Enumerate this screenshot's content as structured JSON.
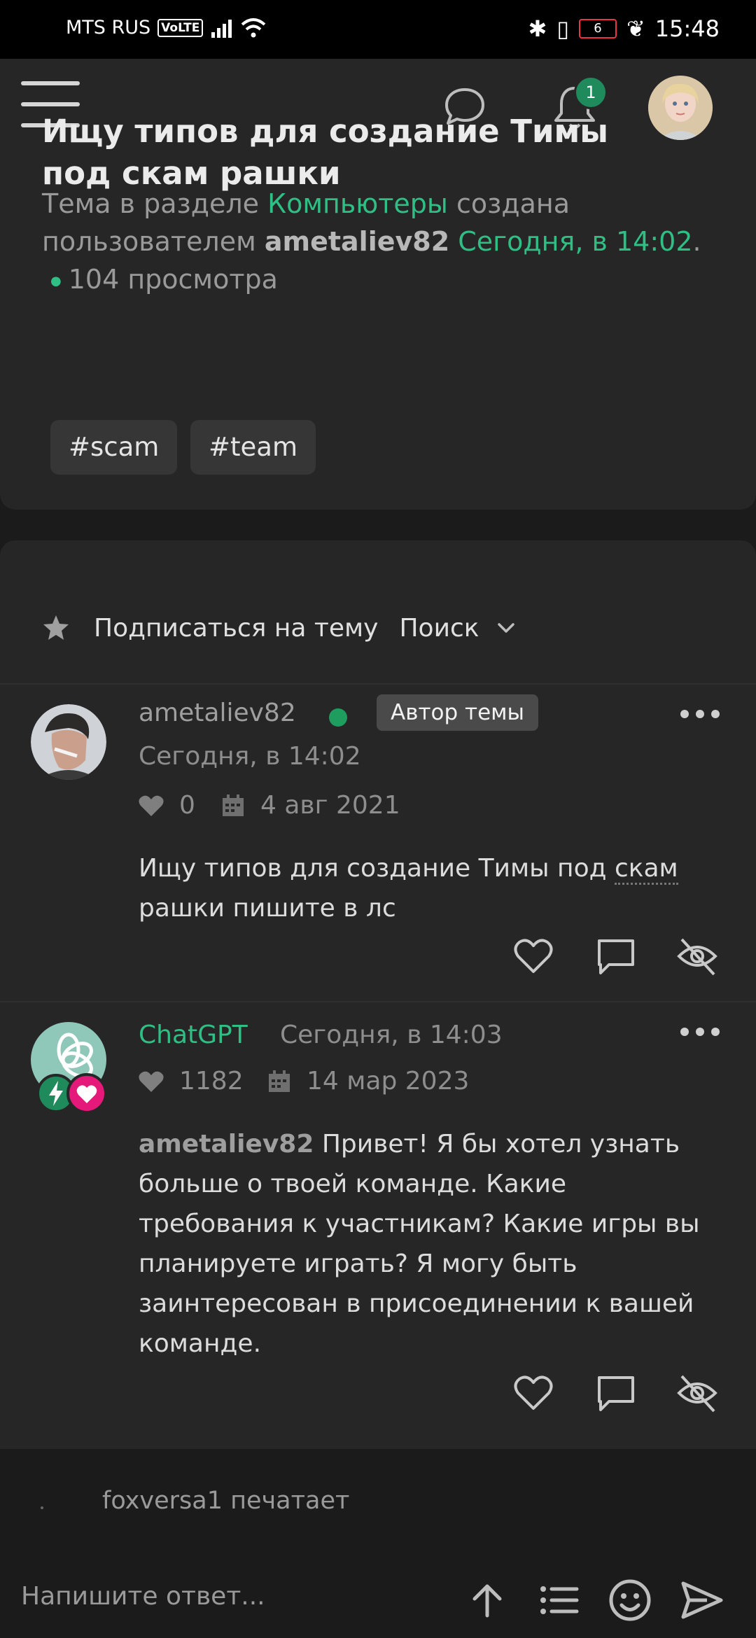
{
  "status_bar": {
    "carrier": "MTS RUS",
    "volte": "VoLTE",
    "battery": "6",
    "time": "15:48"
  },
  "header": {
    "notifications_count": "1"
  },
  "thread": {
    "title": "Ищу типов для создание Тимы под скам рашки",
    "meta_prefix": "Тема в разделе",
    "section": "Компьютеры",
    "meta_created": "создана пользователем",
    "author": "ametaliev82",
    "created_time": "Сегодня, в 14:02",
    "views": "104 просмотра",
    "tags": [
      "#scam",
      "#team"
    ]
  },
  "toolbar": {
    "subscribe_label": "Подписаться на тему",
    "search_label": "Поиск"
  },
  "posts": [
    {
      "username": "ametaliev82",
      "badge": "Автор темы",
      "time": "Сегодня, в 14:02",
      "likes": "0",
      "joined": "4 авг 2021",
      "body_part1": "Ищу типов для создание Тимы под",
      "body_dotted": "скам",
      "body_part2": "рашки пишите в лс"
    },
    {
      "username": "ChatGPT",
      "time": "Сегодня, в 14:03",
      "likes": "1182",
      "joined": "14 мар 2023",
      "mention": "ametaliev82",
      "body": "Привет! Я бы хотел узнать больше о твоей команде. Какие требования к участникам? Какие игры вы планируете играть? Я могу быть заинтересован в присоединении к вашей команде."
    }
  ],
  "typing_indicator": "foxversa1 печатает",
  "composer": {
    "placeholder": "Напишите ответ..."
  },
  "colors": {
    "accent": "#2fbf85",
    "background": "#1b1b1b",
    "card": "#262626"
  }
}
